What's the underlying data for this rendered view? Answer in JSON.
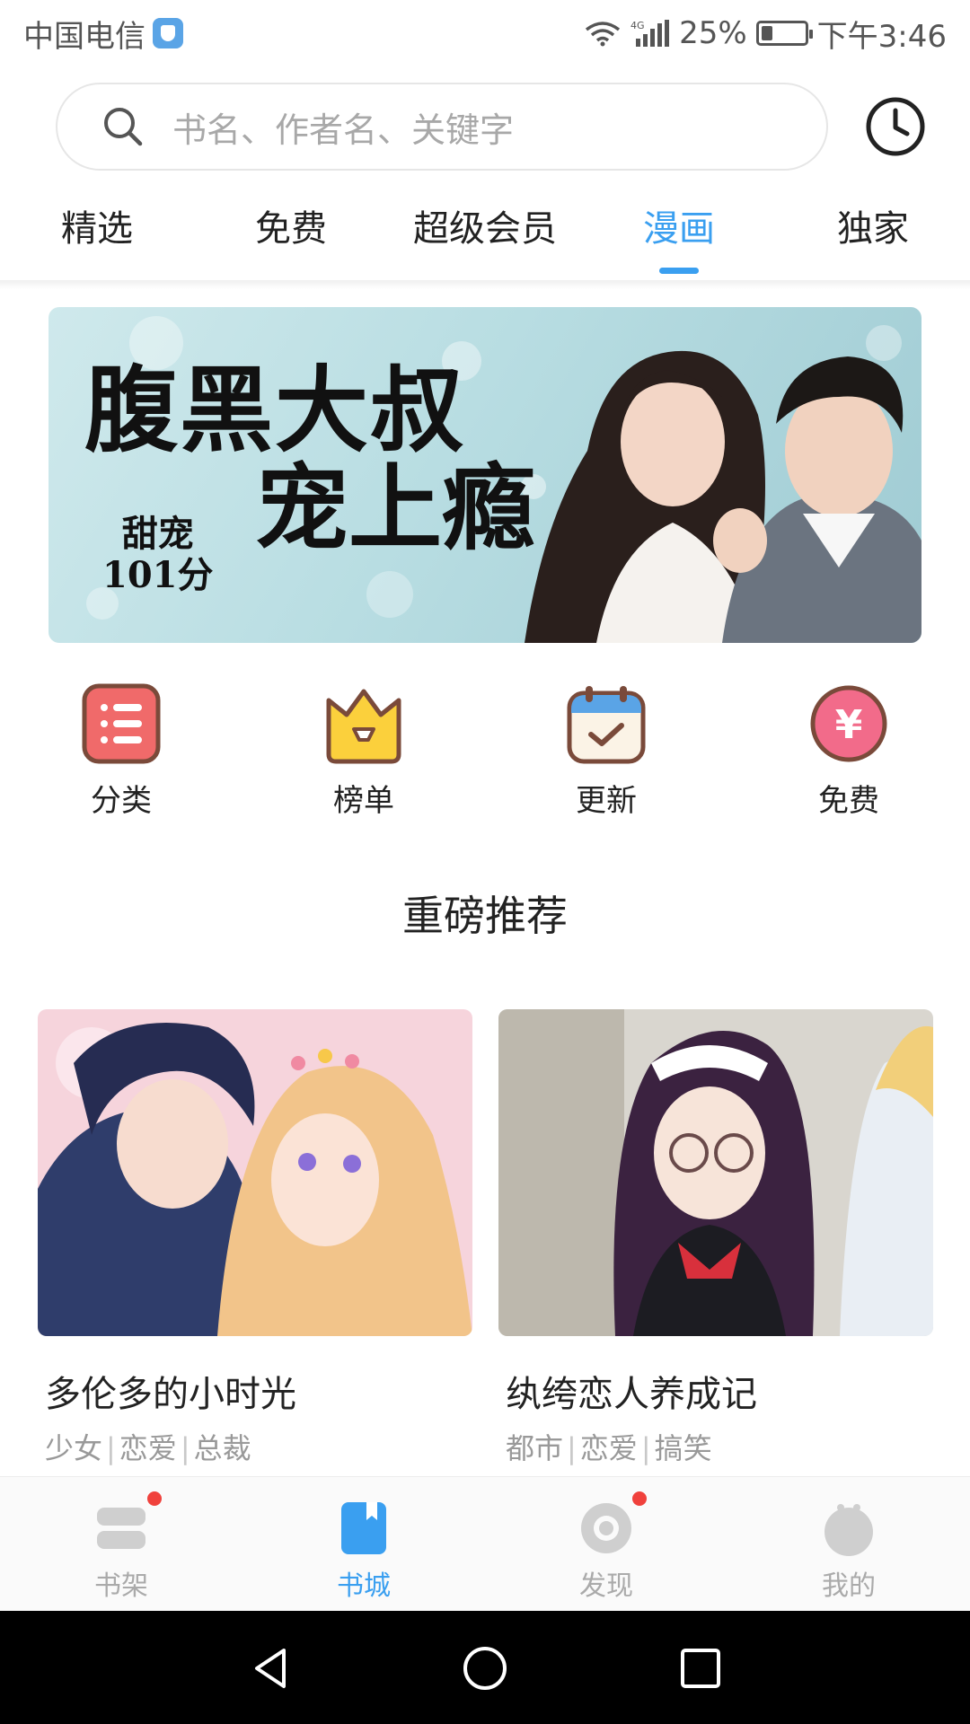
{
  "status_bar": {
    "carrier": "中国电信",
    "network": "4G",
    "battery": "25%",
    "battery_level": 0.25,
    "time": "下午3:46"
  },
  "search": {
    "placeholder": "书名、作者名、关键字"
  },
  "tabs": [
    {
      "label": "精选",
      "active": false
    },
    {
      "label": "免费",
      "active": false
    },
    {
      "label": "超级会员",
      "active": false
    },
    {
      "label": "漫画",
      "active": true
    },
    {
      "label": "独家",
      "active": false
    }
  ],
  "banner": {
    "title_line1": "腹黑大叔",
    "title_line2": "宠上瘾",
    "badge_line1": "甜宠",
    "badge_line2": "101分"
  },
  "shortcuts": [
    {
      "label": "分类",
      "icon": "category-list-icon"
    },
    {
      "label": "榜单",
      "icon": "crown-icon"
    },
    {
      "label": "更新",
      "icon": "calendar-check-icon"
    },
    {
      "label": "免费",
      "icon": "yen-coin-icon"
    }
  ],
  "section": {
    "title": "重磅推荐"
  },
  "cards": [
    {
      "title": "多伦多的小时光",
      "tags": [
        "少女",
        "恋爱",
        "总裁"
      ]
    },
    {
      "title": "纨绔恋人养成记",
      "tags": [
        "都市",
        "恋爱",
        "搞笑"
      ]
    }
  ],
  "bottom_nav": [
    {
      "label": "书架",
      "icon": "bookshelf-icon",
      "active": false,
      "badge": true
    },
    {
      "label": "书城",
      "icon": "book-store-icon",
      "active": true,
      "badge": false
    },
    {
      "label": "发现",
      "icon": "discover-eye-icon",
      "active": false,
      "badge": true
    },
    {
      "label": "我的",
      "icon": "profile-face-icon",
      "active": false,
      "badge": false
    }
  ],
  "colors": {
    "accent": "#3a9ff0",
    "badge_red": "#f0413c",
    "muted_text": "#999999"
  }
}
